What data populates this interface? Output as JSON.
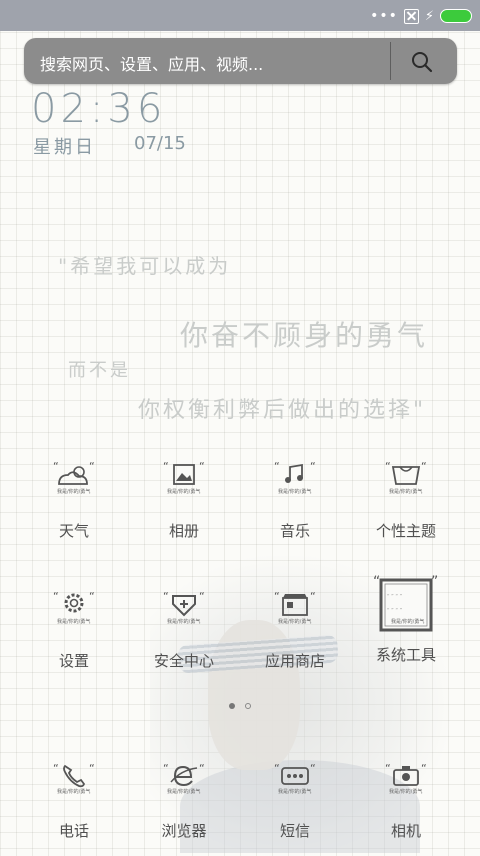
{
  "status_bar": {
    "dots": "•••",
    "icons": [
      "more-dots-icon",
      "sim-off-icon",
      "charging-bolt-icon",
      "battery-icon"
    ],
    "battery_color": "#3ccb3c"
  },
  "search": {
    "placeholder": "搜索网页、设置、应用、视频..."
  },
  "clock": {
    "time": "02:36",
    "weekday": "星期日",
    "date": "07/15"
  },
  "quote": {
    "line1": "\"希望我可以成为",
    "line2": "你奋不顾身的勇气",
    "line3": "而不是",
    "line4": "你权衡利弊后做出的选择\""
  },
  "apps": [
    {
      "label": "天气",
      "icon": "weather-icon"
    },
    {
      "label": "相册",
      "icon": "gallery-icon"
    },
    {
      "label": "音乐",
      "icon": "music-icon"
    },
    {
      "label": "个性主题",
      "icon": "themes-icon"
    },
    {
      "label": "设置",
      "icon": "settings-icon"
    },
    {
      "label": "安全中心",
      "icon": "security-icon"
    },
    {
      "label": "应用商店",
      "icon": "app-store-icon"
    },
    {
      "label": "系统工具",
      "icon": "system-tools-icon"
    },
    {
      "label": "电话",
      "icon": "phone-icon"
    },
    {
      "label": "浏览器",
      "icon": "browser-icon"
    },
    {
      "label": "短信",
      "icon": "messages-icon"
    },
    {
      "label": "相机",
      "icon": "camera-icon"
    }
  ],
  "pagination": {
    "current": 1,
    "total": 2
  }
}
